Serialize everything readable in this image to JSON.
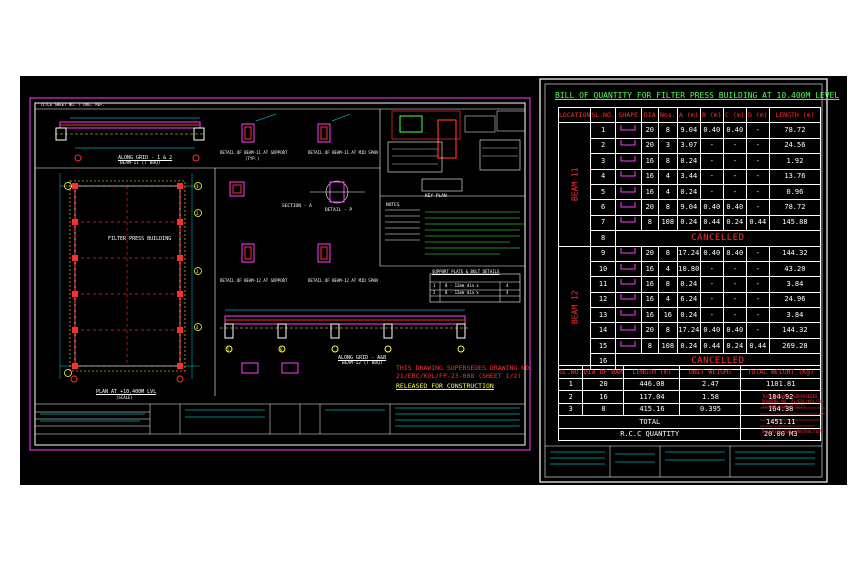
{
  "colors": {
    "background": "#000000",
    "cyan": "#00ffff",
    "magenta": "#ff3cff",
    "red": "#ff2d2d",
    "green": "#4dff4d",
    "yellow": "#ffff33",
    "white": "#ffffff"
  },
  "left_sheet": {
    "header_strip": "TITLE  SHEET NO. / DRG. REF.",
    "view_section_1_1": "ALONG GRID - 1 & 2",
    "view_section_1_1_sub": "BEAM-11 (T BOQ)",
    "detail_beam_11_support": "DETAIL OF BEAM-11 AT SUPPORT",
    "detail_beam_11_mid": "DETAIL OF BEAM-11 AT MID SPAN",
    "section_typ": "(TYP.)",
    "filter_building_label": "FILTER PRESS BUILDING",
    "plan_label": "PLAN AT +10.400M LVL",
    "plan_sub": "(SCALE)",
    "detail_p": "DETAIL - P",
    "section_a": "SECTION - A",
    "key_plan": "KEY PLAN",
    "detail_beam_12_support": "DETAIL OF BEAM-12 AT SUPPORT",
    "detail_beam_12_mid": "DETAIL OF BEAM-12 AT MID SPAN",
    "along_grid_aa": "ALONG GRID - A&B",
    "along_grid_sub": "BEAM-12 (T BOQ)",
    "supersedes_line1": "THIS DRAWING SUPERSEDES DRAWING NO.",
    "supersedes_line2": "21/ERC/KOL/FP-23-008 (SHEET 1/2)",
    "released": "RELEASED FOR CONSTRUCTION",
    "notes_title": "NOTES",
    "mini_table_title": "SUPPORT PLATE & BOLT DETAILS",
    "mini_table_rows": [
      [
        "1",
        "8 - 12mm dia x",
        "4"
      ],
      [
        "2",
        "8 - 12mm dia x",
        "4"
      ]
    ],
    "grid_numbers": [
      "1",
      "2",
      "3",
      "4",
      "5",
      "6"
    ]
  },
  "right_sheet": {
    "title": "BILL OF QUANTITY FOR FILTER PRESS BUILDING AT 10.400M LEVEL",
    "headers": [
      "LOCATION",
      "SL.NO.",
      "SHAPE",
      "DIA",
      "Nos.",
      "A (m)",
      "B (m)",
      "C (m)",
      "D (m)",
      "LENGTH (m)"
    ],
    "groups": [
      {
        "label": "BEAM 11",
        "rows": [
          [
            "1",
            "",
            "20",
            "8",
            "9.04",
            "0.40",
            "0.40",
            "-",
            "78.72"
          ],
          [
            "2",
            "",
            "20",
            "3",
            "3.07",
            "-",
            "-",
            "-",
            "24.56"
          ],
          [
            "3",
            "",
            "16",
            "8",
            "0.24",
            "-",
            "-",
            "-",
            "1.92"
          ],
          [
            "4",
            "",
            "16",
            "4",
            "3.44",
            "-",
            "-",
            "-",
            "13.76"
          ],
          [
            "5",
            "",
            "16",
            "4",
            "0.24",
            "-",
            "-",
            "-",
            "0.96"
          ],
          [
            "6",
            "",
            "20",
            "8",
            "9.04",
            "0.40",
            "0.40",
            "-",
            "78.72"
          ],
          [
            "7",
            "",
            "8",
            "108",
            "0.24",
            "0.44",
            "0.24",
            "0.44",
            "145.88"
          ]
        ],
        "cancelled_row": "8",
        "cancelled_text": "CANCELLED"
      },
      {
        "label": "BEAM 12",
        "rows": [
          [
            "9",
            "",
            "20",
            "8",
            "17.24",
            "0.40",
            "0.40",
            "-",
            "144.32"
          ],
          [
            "10",
            "",
            "16",
            "4",
            "10.80",
            "-",
            "-",
            "-",
            "43.20"
          ],
          [
            "11",
            "",
            "16",
            "8",
            "0.24",
            "-",
            "-",
            "-",
            "3.84"
          ],
          [
            "12",
            "",
            "16",
            "4",
            "6.24",
            "-",
            "-",
            "-",
            "24.96"
          ],
          [
            "13",
            "",
            "16",
            "16",
            "0.24",
            "-",
            "-",
            "-",
            "3.84"
          ],
          [
            "14",
            "",
            "20",
            "8",
            "17.24",
            "0.40",
            "0.40",
            "-",
            "144.32"
          ],
          [
            "15",
            "",
            "8",
            "108",
            "0.24",
            "0.44",
            "0.24",
            "0.44",
            "269.28"
          ]
        ],
        "cancelled_row": "16",
        "cancelled_text": "CANCELLED"
      }
    ],
    "summary_headers": [
      "SL.NO.",
      "DIA OF BAR",
      "LENGTH (m)",
      "UNIT WEIGHT",
      "TOTAL WEIGHT (Kg)"
    ],
    "summary_rows": [
      [
        "1",
        "20",
        "446.08",
        "2.47",
        "1101.81"
      ],
      [
        "2",
        "16",
        "117.04",
        "1.58",
        "184.92"
      ],
      [
        "3",
        "8",
        "415.16",
        "0.395",
        "164.38"
      ]
    ],
    "total_label": "TOTAL",
    "total_value": "1451.11",
    "rcc_label": "R.C.C QUANTITY",
    "rcc_value": "20.00 M3",
    "side_note_red": "THIS DRAWING SUPERSEDES DRAWING NO. 21/ERC/KOL/FP-23-008 (SHEET 2/2)",
    "side_note_red2": "RELEASED FOR CONSTRUCTION"
  }
}
